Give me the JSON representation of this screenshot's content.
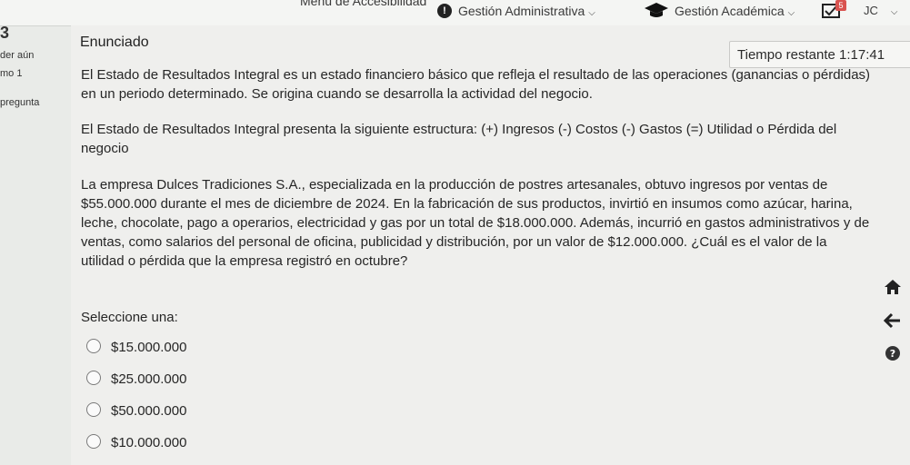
{
  "topbar": {
    "accessibility_menu": "Menú de Accesibilidad",
    "admin_menu": "Gestión Administrativa",
    "academic_menu": "Gestión Académica",
    "notification_count": "5",
    "user_initials": "JC"
  },
  "left_nav": {
    "question_number": "3",
    "status": "der aún",
    "marked": "mo 1",
    "question_label": "pregunta"
  },
  "question": {
    "heading": "Enunciado",
    "timer_label": "Tiempo restante",
    "timer_value": "1:17:41",
    "paragraph1": "El Estado de Resultados Integral es un estado financiero básico que refleja el resultado de las operaciones (ganancias o pérdidas) en un periodo determinado. Se origina cuando se desarrolla la actividad del negocio.",
    "paragraph2": "El Estado de Resultados Integral presenta la siguiente estructura: (+) Ingresos (-) Costos (-) Gastos (=) Utilidad o Pérdida del negocio",
    "paragraph3": "La empresa Dulces Tradiciones S.A., especializada en la producción de postres artesanales, obtuvo ingresos por ventas de $55.000.000 durante el mes de diciembre de 2024. En la fabricación de sus productos, invirtió en insumos como azúcar, harina, leche, chocolate, pago a operarios, electricidad y gas por un total de $18.000.000. Además, incurrió en gastos administrativos y de ventas, como salarios del personal de oficina, publicidad y distribución, por un valor de $12.000.000. ¿Cuál es el valor de la utilidad o pérdida que la empresa registró en octubre?",
    "select_label": "Seleccione una:",
    "options": [
      "$15.000.000",
      "$25.000.000",
      "$50.000.000",
      "$10.000.000"
    ]
  },
  "icons": {
    "home": "home-icon",
    "back": "arrow-left-icon",
    "help": "question-icon"
  }
}
